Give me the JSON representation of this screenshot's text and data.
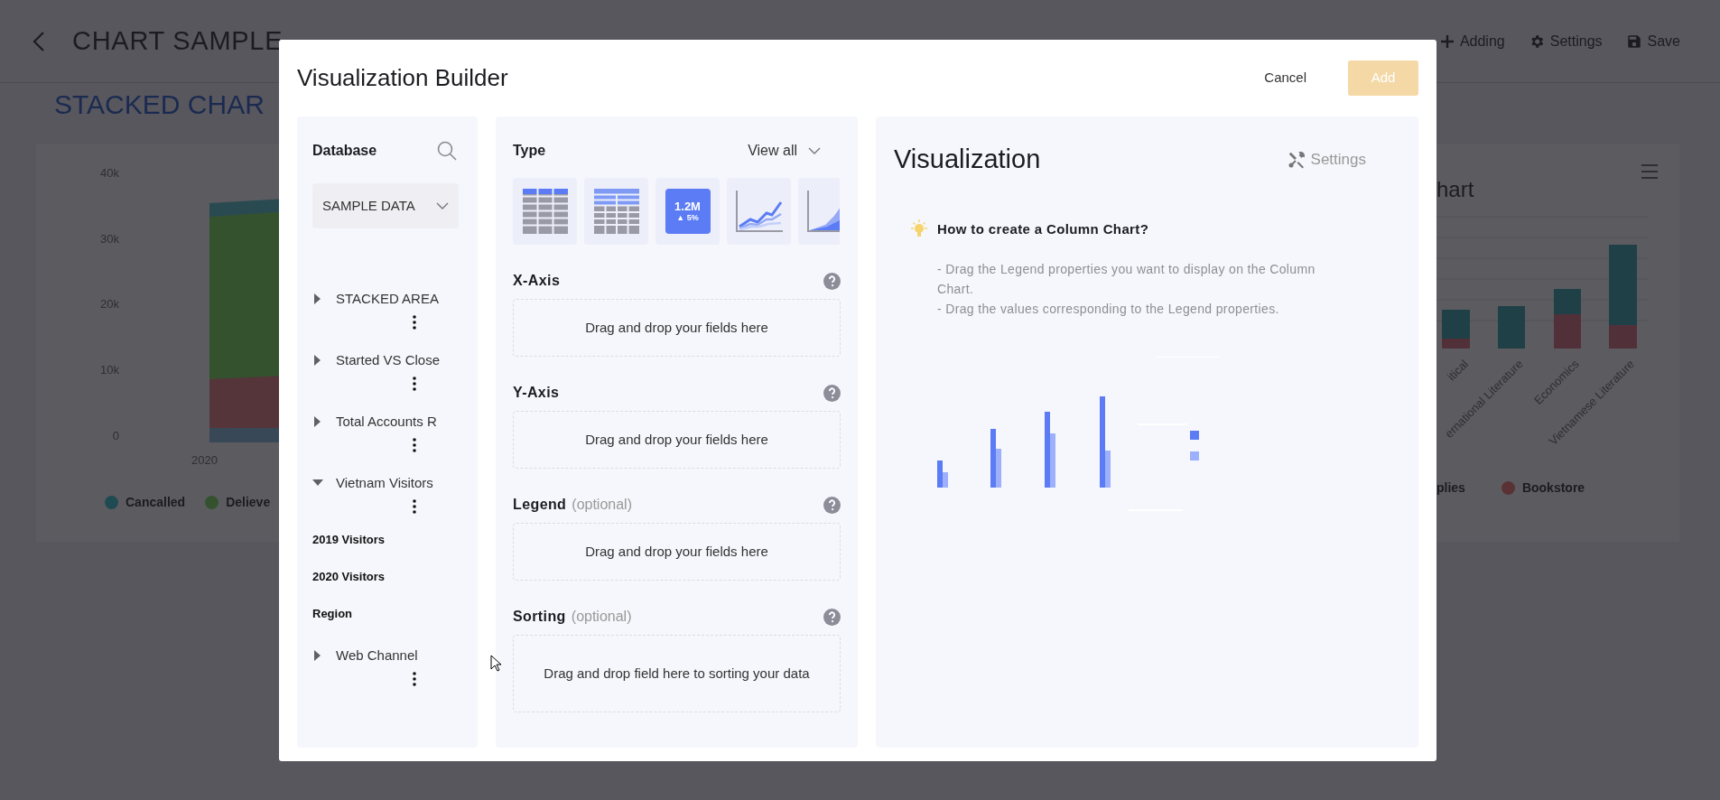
{
  "page": {
    "title": "CHART SAMPLE",
    "toolbar": [
      {
        "kind": "add",
        "label": "Adding"
      },
      {
        "kind": "settings",
        "label": "Settings"
      },
      {
        "kind": "save",
        "label": "Save"
      }
    ],
    "section_title": "STACKED CHAR"
  },
  "left_card": {
    "y_ticks": [
      "40k",
      "30k",
      "20k",
      "10k",
      "0"
    ],
    "x_labels": [
      "2020"
    ],
    "legend": [
      {
        "label": "Cancalled",
        "color": "#1f4a52"
      },
      {
        "label": "Delieve",
        "color": "#35522f"
      }
    ]
  },
  "right_card": {
    "title": "hart",
    "x_labels": [
      "itical",
      "ernational Literature",
      "Economics",
      "Vietnamese Literature"
    ],
    "legend": [
      {
        "label": "plies"
      },
      {
        "label": "Bookstore",
        "color": "#5a3236"
      }
    ]
  },
  "modal": {
    "title": "Visualization Builder",
    "cancel": "Cancel",
    "add": {
      "label": "Add",
      "disabled": true
    },
    "database": {
      "title": "Database",
      "dropdown": "SAMPLE DATA",
      "items": [
        {
          "label": "STACKED AREA",
          "expanded": false
        },
        {
          "label": "Started VS Close",
          "expanded": false
        },
        {
          "label": "Total Accounts R",
          "expanded": false
        },
        {
          "label": "Vietnam Visitors",
          "expanded": true,
          "children": [
            {
              "label": "2019 Visitors"
            },
            {
              "label": "2020 Visitors"
            },
            {
              "label": "Region"
            }
          ]
        },
        {
          "label": "Web Channel",
          "expanded": false
        }
      ]
    },
    "builder": {
      "type_label": "Type",
      "view_all": "View all",
      "chart_types": [
        {
          "kind": "table"
        },
        {
          "kind": "pivot"
        },
        {
          "kind": "number",
          "value": "1.2M",
          "change": "▲ 5%"
        },
        {
          "kind": "line"
        },
        {
          "kind": "area"
        }
      ],
      "fields": [
        {
          "label": "X-Axis",
          "hint": "Drag and drop your fields here"
        },
        {
          "label": "Y-Axis",
          "hint": "Drag and drop your fields here"
        },
        {
          "label": "Legend",
          "optional": "(optional)",
          "hint": "Drag and drop your fields here"
        },
        {
          "label": "Sorting",
          "optional": "(optional)",
          "hint": "Drag and drop field here to sorting your data"
        }
      ]
    },
    "visualization": {
      "title": "Visualization",
      "settings": "Settings",
      "tip_title": "How to create a Column Chart?",
      "tip_lines": [
        "- Drag the Legend properties you want to display on the Column Chart.",
        "- Drag the values corresponding to the Legend properties."
      ]
    }
  }
}
